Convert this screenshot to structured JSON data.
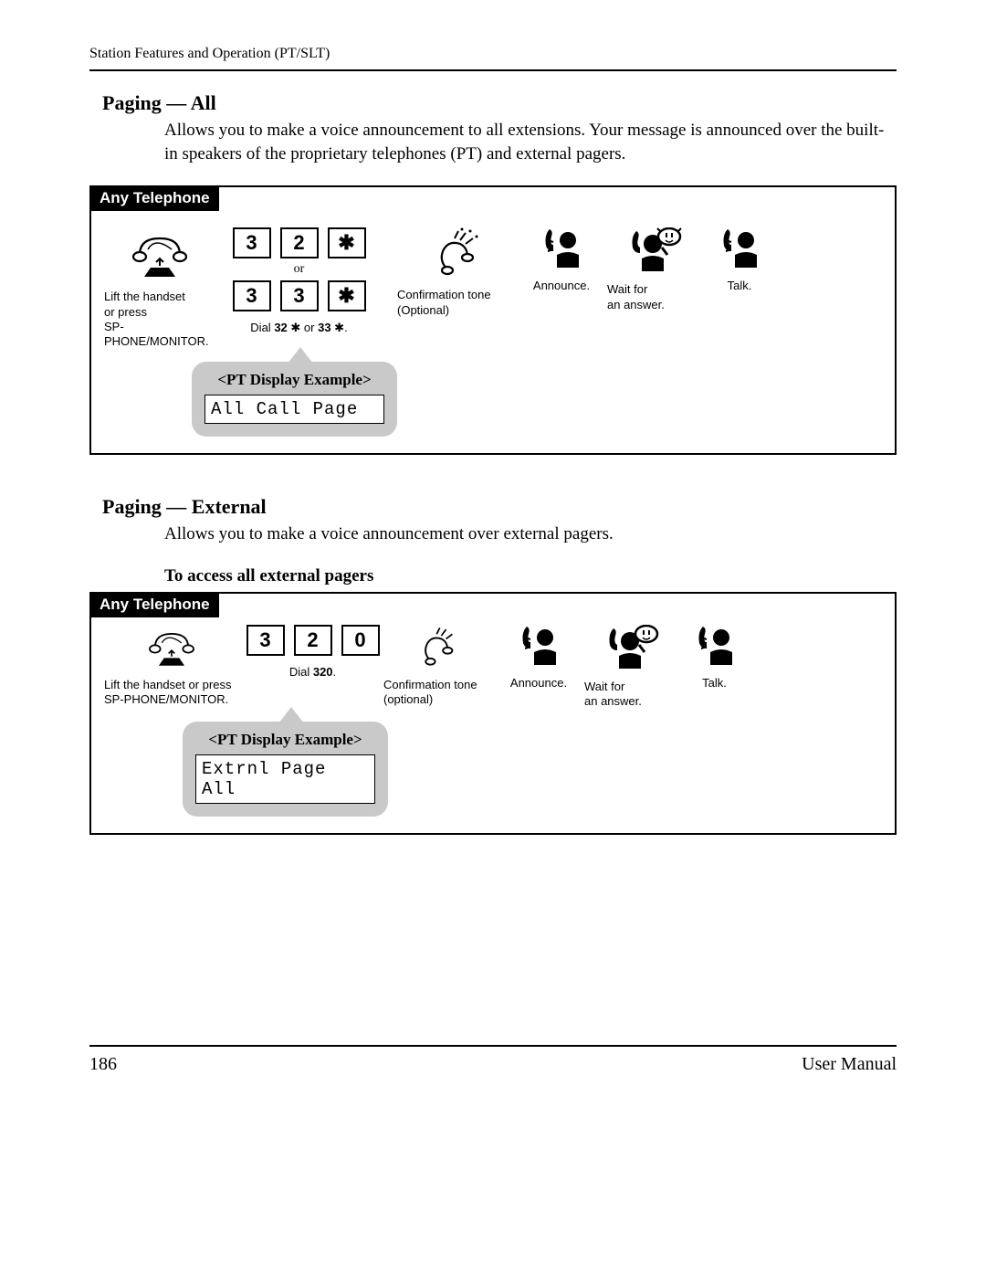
{
  "header": "Station Features and Operation (PT/SLT)",
  "section1": {
    "title": "Paging — All",
    "body": "Allows you to make a voice announcement to all extensions. Your message is announced over the built-in speakers of the proprietary telephones (PT) and external pagers."
  },
  "section2": {
    "title": "Paging — External",
    "body": "Allows you to make a voice announcement over external pagers.",
    "subhead": "To access all external pagers"
  },
  "panel1": {
    "tab": "Any Telephone",
    "lift_caption": "Lift the handset\nor press\nSP-PHONE/MONITOR.",
    "keys_row1": [
      "3",
      "2",
      "✱"
    ],
    "or": "or",
    "keys_row2": [
      "3",
      "3",
      "✱"
    ],
    "dial_parts": [
      "Dial ",
      "32 ",
      "✱",
      " or ",
      "33 ",
      "✱",
      "."
    ],
    "conf_caption": "Confirmation tone\n(Optional)",
    "announce_caption": "Announce.",
    "wait_caption": "Wait for\nan answer.",
    "talk_caption": "Talk.",
    "bubble_title": "<PT Display Example>",
    "lcd": "All Call Page"
  },
  "panel2": {
    "tab": "Any Telephone",
    "lift_caption": "Lift the handset or press\nSP-PHONE/MONITOR.",
    "keys": [
      "3",
      "2",
      "0"
    ],
    "dial_parts": [
      "Dial ",
      "320",
      "."
    ],
    "conf_caption": "Confirmation tone\n(optional)",
    "announce_caption": "Announce.",
    "wait_caption": "Wait for\nan answer.",
    "talk_caption": "Talk.",
    "bubble_title": "<PT Display Example>",
    "lcd": "Extrnl Page All"
  },
  "footer": {
    "page": "186",
    "label": "User Manual"
  }
}
